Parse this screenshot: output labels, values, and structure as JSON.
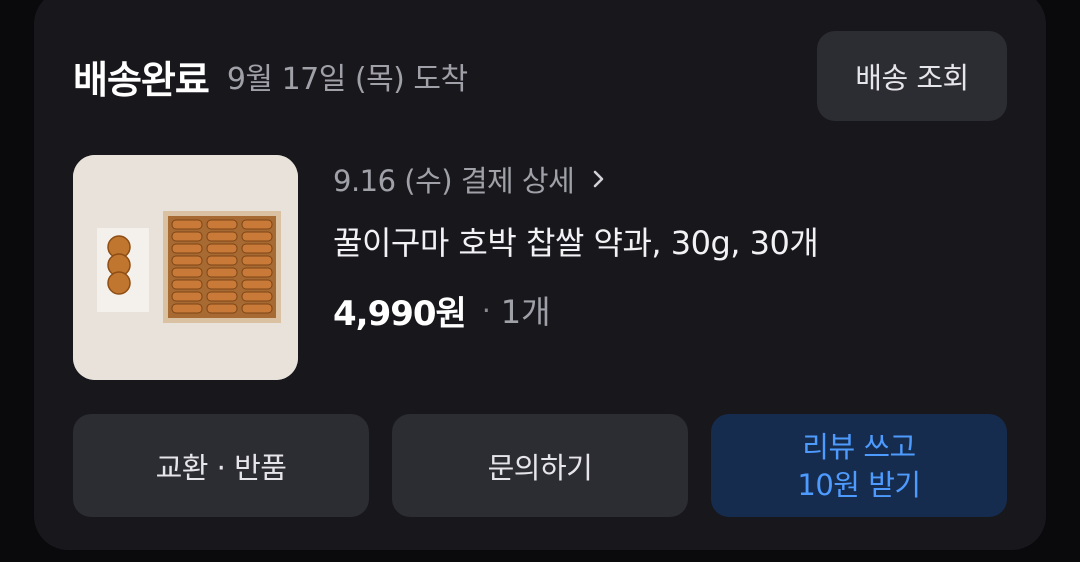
{
  "header": {
    "status": "배송완료",
    "arrival": "9월 17일 (목) 도착",
    "track_button": "배송 조회"
  },
  "product": {
    "image_alt": "product-image",
    "order_detail_link": "9.16 (수) 결제 상세",
    "name": "꿀이구마 호박 찹쌀 약과, 30g, 30개",
    "price": "4,990원",
    "separator": "·",
    "quantity": "1개"
  },
  "actions": {
    "exchange_return": "교환 · 반품",
    "inquiry": "문의하기",
    "review_line1": "리뷰 쓰고",
    "review_line2": "10원 받기"
  },
  "colors": {
    "background": "#0a0a0c",
    "card": "#17171c",
    "button": "#2c2c33",
    "review_button": "#162c4e",
    "review_text": "#4e9bff"
  }
}
